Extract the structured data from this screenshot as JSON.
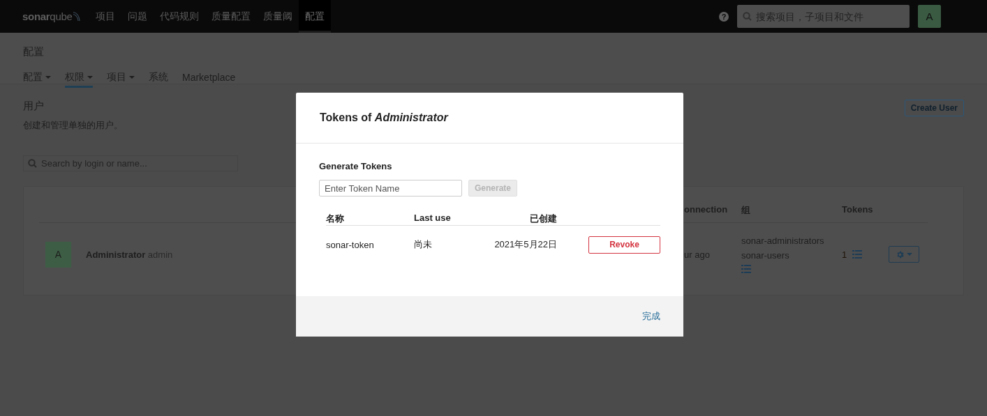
{
  "top_nav": {
    "logo": "**sonar**qube",
    "items": [
      {
        "label": "项目",
        "selected": false
      },
      {
        "label": "问题",
        "selected": false
      },
      {
        "label": "代码规则",
        "selected": false
      },
      {
        "label": "质量配置",
        "selected": false
      },
      {
        "label": "质量阈",
        "selected": false
      },
      {
        "label": "配置",
        "selected": true
      }
    ],
    "help": "?",
    "search": {
      "placeholder": "搜索项目，子项目和文件"
    },
    "avatar": "A"
  },
  "page_header": {
    "title": "配置",
    "tabs": [
      {
        "label": "配置",
        "dropdown": true,
        "selected": false
      },
      {
        "label": "权限",
        "dropdown": true,
        "selected": true
      },
      {
        "label": "项目",
        "dropdown": true,
        "selected": false
      },
      {
        "label": "系统",
        "dropdown": false,
        "selected": false
      },
      {
        "label": "Marketplace",
        "dropdown": false,
        "selected": false
      }
    ]
  },
  "users": {
    "title": "用户",
    "description": "创建和管理单独的用户。",
    "create_button": "Create User",
    "search": {
      "placeholder": "Search by login or name..."
    },
    "table": {
      "columns": [
        "onnection",
        "组",
        "Tokens"
      ],
      "rows": [
        {
          "avatar": "A",
          "name": "Administrator",
          "login": "admin",
          "last_connection": "ur ago",
          "groups": [
            "sonar-administrators",
            "sonar-users"
          ],
          "tokens": "1"
        }
      ]
    }
  },
  "modal": {
    "title": "Tokens of *Administrator*",
    "generate_heading": "Generate Tokens",
    "input": {
      "placeholder": "Enter Token Name"
    },
    "generate_button": {
      "label": "Generate",
      "disabled": true
    },
    "columns": [
      "名称",
      "Last use",
      "已创建"
    ],
    "tokens": [
      {
        "name": "sonar-token",
        "last_use": "尚未",
        "created": "2021年5月22日",
        "action": "Revoke"
      }
    ],
    "done": "完成"
  }
}
